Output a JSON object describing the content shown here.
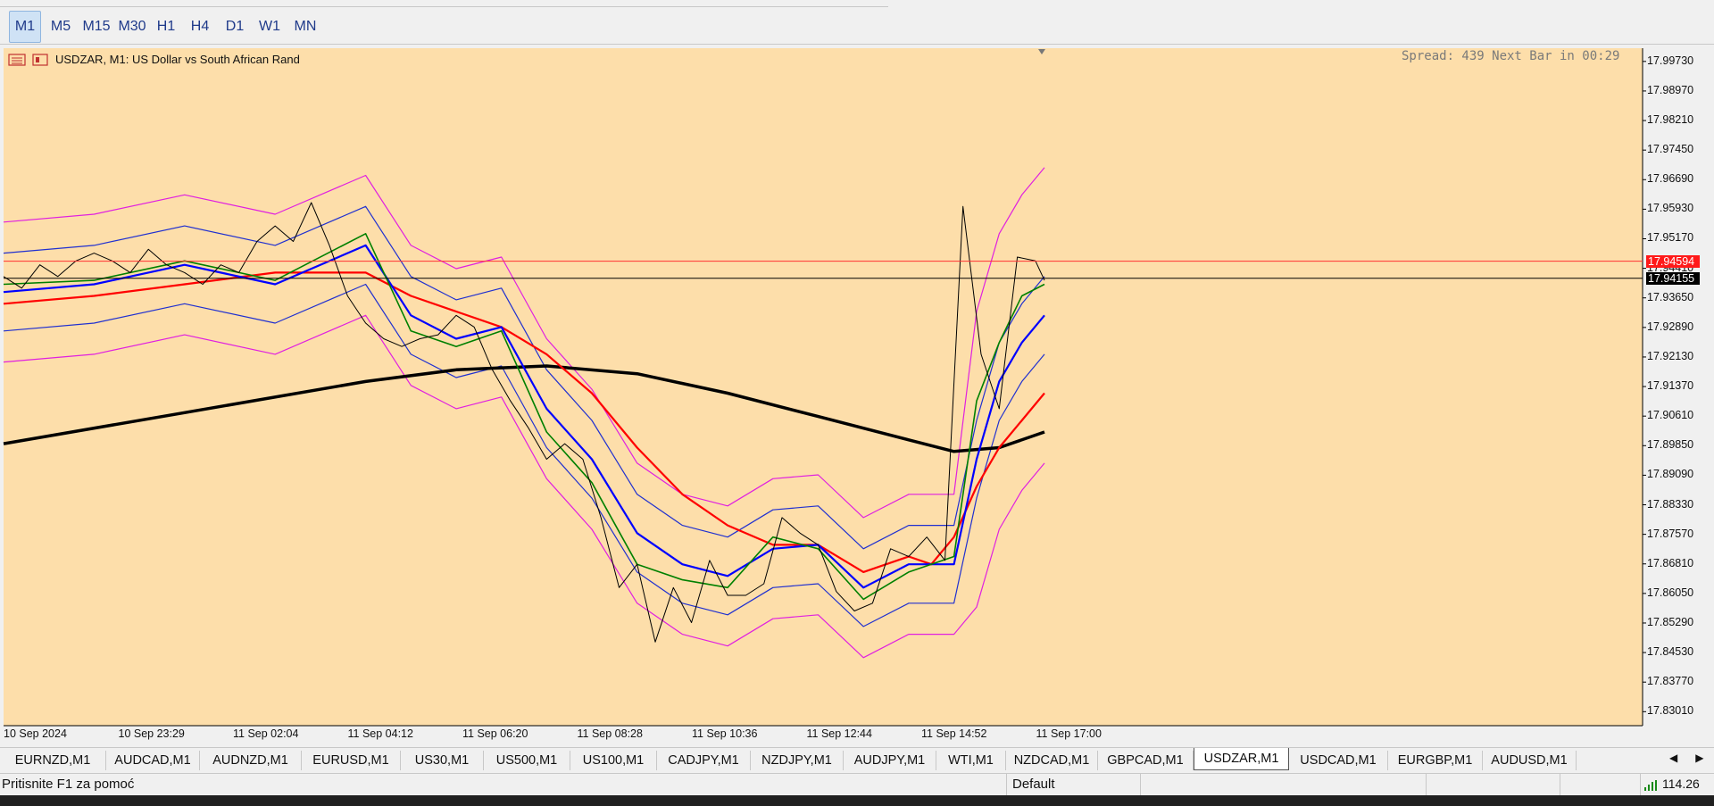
{
  "timeframes": [
    "M1",
    "M5",
    "M15",
    "M30",
    "H1",
    "H4",
    "D1",
    "W1",
    "MN"
  ],
  "active_timeframe": "M1",
  "chart": {
    "title": "USDZAR, M1:  US Dollar vs South African Rand",
    "spread_text": "Spread: 439 Next Bar in 00:29",
    "background": "#fddeaa",
    "bid_price": "17.94155",
    "ask_price": "17.94594"
  },
  "chart_data": {
    "type": "line",
    "symbol": "USDZAR",
    "timeframe": "M1",
    "y_ticks": [
      "17.99730",
      "17.98970",
      "17.98210",
      "17.97450",
      "17.96690",
      "17.95930",
      "17.95170",
      "17.94410",
      "17.93650",
      "17.92890",
      "17.92130",
      "17.91370",
      "17.90610",
      "17.89850",
      "17.89090",
      "17.88330",
      "17.87570",
      "17.86810",
      "17.86050",
      "17.85290",
      "17.84530",
      "17.83770",
      "17.83010"
    ],
    "x_ticks": [
      "10 Sep 2024",
      "10 Sep 23:29",
      "11 Sep 02:04",
      "11 Sep 04:12",
      "11 Sep 06:20",
      "11 Sep 08:28",
      "11 Sep 10:36",
      "11 Sep 12:44",
      "11 Sep 14:52",
      "11 Sep 17:00"
    ],
    "ylim": [
      17.8265,
      18.0007
    ],
    "bid_line": 17.94155,
    "ask_line": 17.94594,
    "price_x": [
      0,
      4,
      8,
      12,
      16,
      20,
      24,
      28,
      32,
      36,
      40,
      44,
      48,
      52,
      56,
      60,
      64,
      68,
      72,
      76,
      80,
      84,
      88,
      92,
      96,
      100,
      104,
      108,
      112,
      116,
      120,
      124,
      128,
      132,
      136,
      140,
      144,
      148,
      152,
      156,
      160,
      164,
      168,
      172,
      176,
      180,
      184,
      188,
      192,
      196,
      200,
      204,
      208,
      212,
      216,
      220,
      224,
      228,
      230
    ],
    "price": [
      17.942,
      17.939,
      17.945,
      17.942,
      17.946,
      17.948,
      17.946,
      17.943,
      17.949,
      17.945,
      17.943,
      17.94,
      17.945,
      17.943,
      17.951,
      17.955,
      17.951,
      17.961,
      17.95,
      17.937,
      17.93,
      17.926,
      17.924,
      17.926,
      17.927,
      17.932,
      17.929,
      17.918,
      17.91,
      17.903,
      17.895,
      17.899,
      17.895,
      17.88,
      17.862,
      17.868,
      17.848,
      17.862,
      17.853,
      17.869,
      17.86,
      17.86,
      17.863,
      17.88,
      17.876,
      17.873,
      17.861,
      17.856,
      17.858,
      17.872,
      17.87,
      17.875,
      17.869,
      17.96,
      17.922,
      17.908,
      17.947,
      17.946,
      17.941
    ],
    "series": [
      {
        "color": "#000000",
        "x": [
          0,
          40,
          80,
          100,
          120,
          140,
          160,
          180,
          190,
          200,
          210,
          220,
          230
        ],
        "values": [
          17.899,
          17.907,
          17.915,
          17.918,
          17.919,
          17.917,
          17.912,
          17.906,
          17.903,
          17.9,
          17.897,
          17.898,
          17.902
        ]
      },
      {
        "color": "#ff0000",
        "x": [
          0,
          20,
          40,
          60,
          80,
          90,
          100,
          110,
          120,
          130,
          140,
          150,
          160,
          170,
          180,
          190,
          200,
          205,
          210,
          215,
          220,
          225,
          230
        ],
        "values": [
          17.935,
          17.937,
          17.94,
          17.943,
          17.943,
          17.937,
          17.933,
          17.929,
          17.922,
          17.912,
          17.898,
          17.886,
          17.878,
          17.873,
          17.873,
          17.866,
          17.87,
          17.868,
          17.875,
          17.888,
          17.898,
          17.905,
          17.912
        ]
      },
      {
        "color": "#0000ff",
        "x": [
          0,
          20,
          40,
          60,
          80,
          90,
          100,
          110,
          120,
          130,
          140,
          150,
          160,
          170,
          180,
          190,
          200,
          210,
          215,
          220,
          225,
          230
        ],
        "values": [
          17.938,
          17.94,
          17.945,
          17.94,
          17.95,
          17.932,
          17.926,
          17.929,
          17.908,
          17.895,
          17.876,
          17.868,
          17.865,
          17.872,
          17.873,
          17.862,
          17.868,
          17.868,
          17.895,
          17.915,
          17.925,
          17.932
        ]
      },
      {
        "color": "#008000",
        "x": [
          0,
          20,
          40,
          60,
          80,
          90,
          100,
          110,
          120,
          130,
          140,
          150,
          160,
          170,
          180,
          190,
          200,
          210,
          215,
          220,
          225,
          230
        ],
        "values": [
          17.94,
          17.941,
          17.946,
          17.941,
          17.953,
          17.928,
          17.924,
          17.928,
          17.902,
          17.889,
          17.868,
          17.864,
          17.862,
          17.875,
          17.872,
          17.859,
          17.866,
          17.87,
          17.91,
          17.925,
          17.937,
          17.94
        ]
      }
    ]
  },
  "symbol_tabs": [
    "EURNZD,M1",
    "AUDCAD,M1",
    "AUDNZD,M1",
    "EURUSD,M1",
    "US30,M1",
    "US500,M1",
    "US100,M1",
    "CADJPY,M1",
    "NZDJPY,M1",
    "AUDJPY,M1",
    "WTI,M1",
    "NZDCAD,M1",
    "GBPCAD,M1",
    "USDZAR,M1",
    "USDCAD,M1",
    "EURGBP,M1",
    "AUDUSD,M1"
  ],
  "active_symbol_tab": "USDZAR,M1",
  "status": {
    "help_text": "Pritisnite F1 za pomoć",
    "profile": "Default",
    "connection": "114.26"
  }
}
